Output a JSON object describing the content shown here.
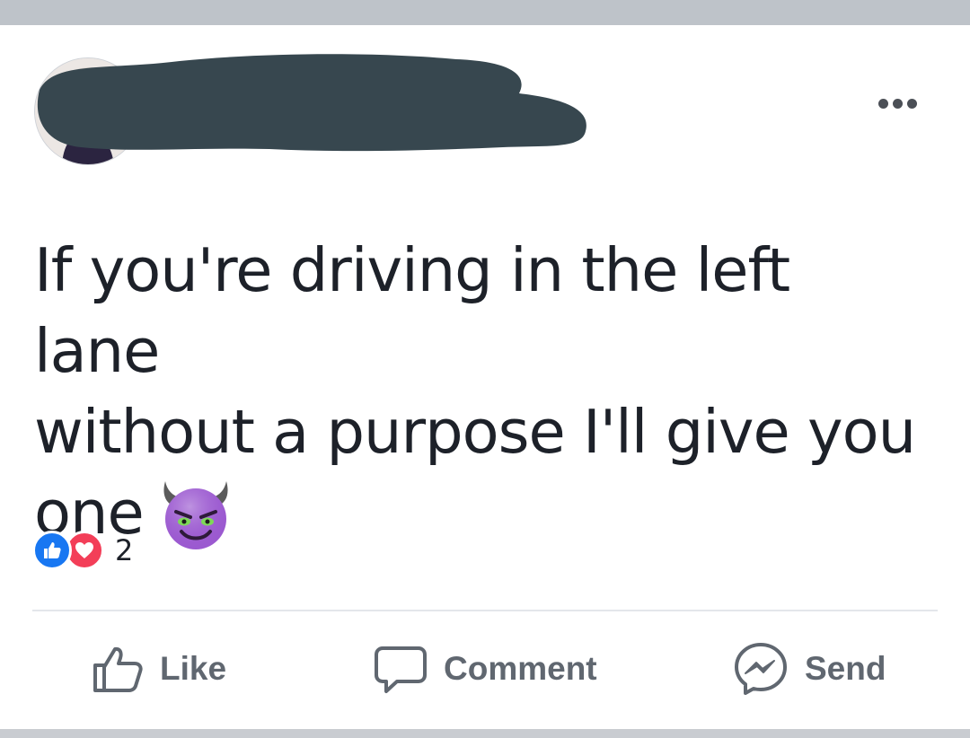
{
  "post": {
    "text_line_1": "If you're driving in the left lane",
    "text_line_2": "without a purpose I'll give you",
    "text_line_3": "one",
    "emoji": "smiling-imp-emoji"
  },
  "header": {
    "author": "",
    "redacted": true,
    "more_icon": "more-dots-icon"
  },
  "reactions": {
    "types": [
      "like",
      "love"
    ],
    "count": "2"
  },
  "actions": {
    "like_label": "Like",
    "comment_label": "Comment",
    "send_label": "Send"
  },
  "colors": {
    "text": "#1d2129",
    "action_text": "#606770",
    "like_blue": "#1877f2",
    "love_red": "#f33e58",
    "redaction": "#37474f",
    "top_bar": "#bec3c9"
  }
}
